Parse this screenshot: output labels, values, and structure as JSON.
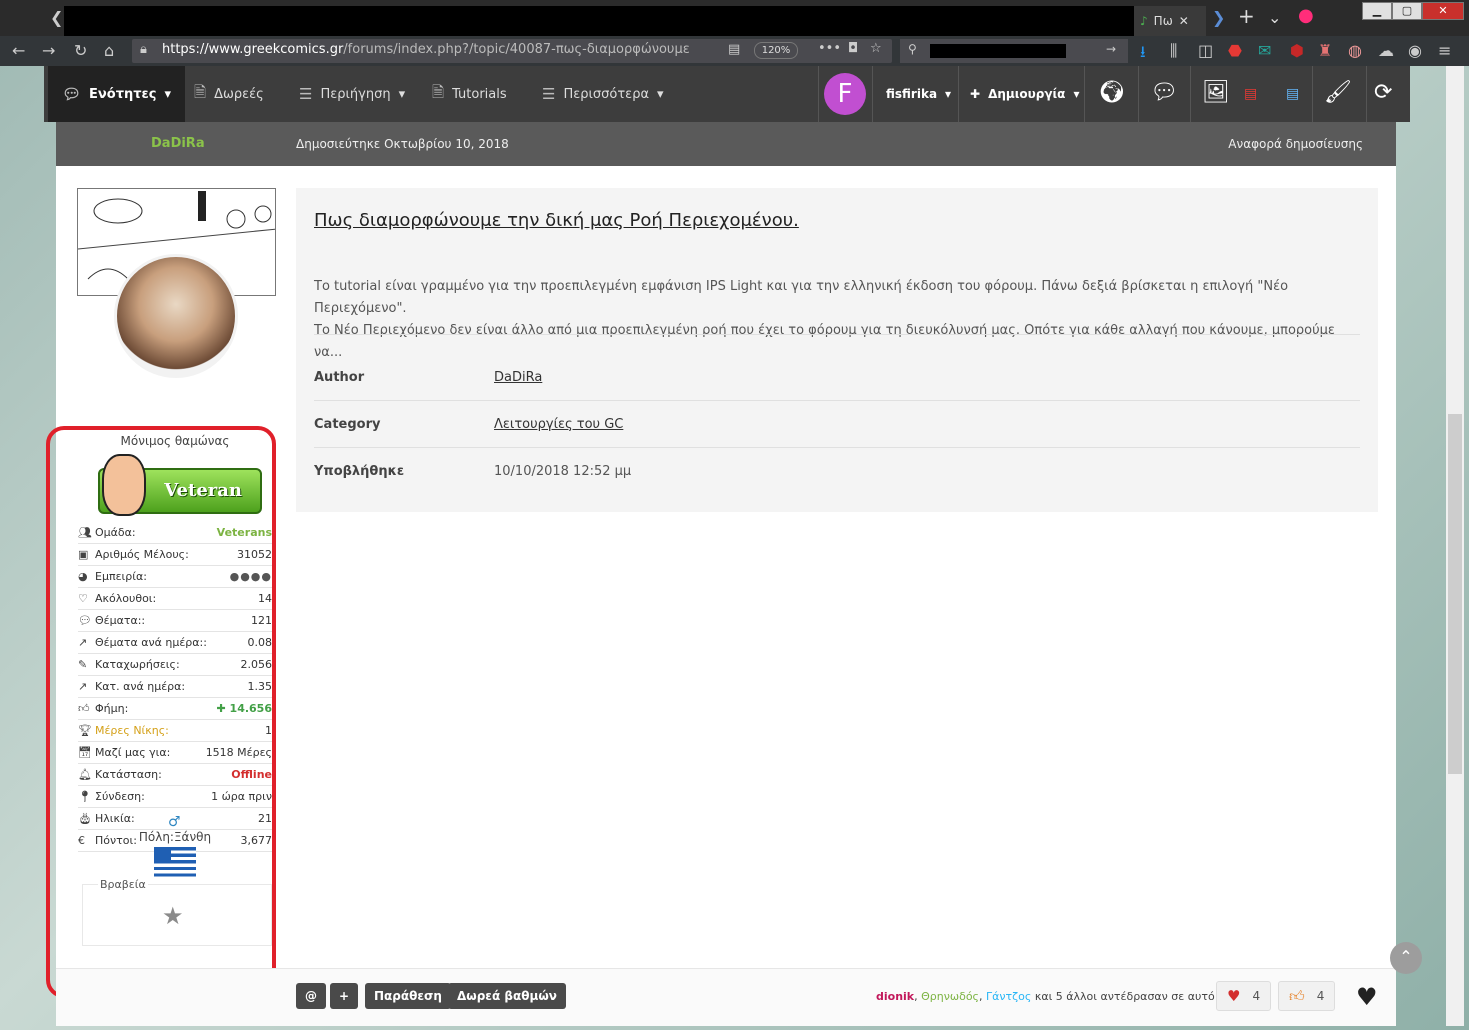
{
  "browser": {
    "tab_title": "Πω",
    "url_host": "https://www.greekcomics.gr",
    "url_path": "/forums/index.php?/topic/40087-πως-διαμορφώνουμε",
    "zoom": "120%"
  },
  "site_nav": {
    "items": [
      {
        "label": "Ενότητες",
        "icon": "comments-icon",
        "active": true
      },
      {
        "label": "Δωρεές",
        "icon": "document-icon"
      },
      {
        "label": "Περιήγηση",
        "icon": "list-icon"
      },
      {
        "label": "Tutorials",
        "icon": "document-icon"
      },
      {
        "label": "Περισσότερα",
        "icon": "list-icon"
      }
    ],
    "avatar_letter": "F",
    "username": "fisfirika",
    "create_label": "Δημιουργία",
    "avatar_color": "#c14fd1"
  },
  "post": {
    "author": "DaDiRa",
    "date": "Δημοσιεύτηκε Οκτωβρίου 10, 2018",
    "report_label": "Αναφορά δημοσίευσης"
  },
  "user_panel": {
    "rank_title": "Μόνιμος θαμώνας",
    "badge_text": "Veteran",
    "stats": [
      {
        "label": "Ομάδα:",
        "value": "Veterans",
        "style": "green"
      },
      {
        "label": "Αριθμός Μέλους:",
        "value": "31052"
      },
      {
        "label": "Εμπειρία:",
        "value": "●●●●"
      },
      {
        "label": "Ακόλουθοι:",
        "value": "14"
      },
      {
        "label": "Θέματα::",
        "value": "121"
      },
      {
        "label": "Θέματα ανά ημέρα::",
        "value": "0.08"
      },
      {
        "label": "Καταχωρήσεις:",
        "value": "2.056"
      },
      {
        "label": "Κατ. ανά ημέρα:",
        "value": "1.35"
      },
      {
        "label": "Φήμη:",
        "value": "✚ 14.656",
        "style": "rep"
      },
      {
        "label": "Μέρες Νίκης:",
        "value": "1",
        "style": "gold"
      },
      {
        "label": "Μαζί μας για:",
        "value": "1518 Μέρες"
      },
      {
        "label": "Κατάσταση:",
        "value": "Offline",
        "style": "red"
      },
      {
        "label": "Σύνδεση:",
        "value": "1 ώρα πριν"
      },
      {
        "label": "Ηλικία:",
        "value": "21"
      },
      {
        "label": "Πόντοι:",
        "value": "3,677"
      }
    ],
    "city": "Πόλη:Ξάνθη",
    "awards_label": "Βραβεία"
  },
  "content": {
    "title": "Πως διαμορφώνουμε την δική μας Ροή Περιεχομένου.",
    "summary_line1": "Το tutorial είναι γραμμένο για την προεπιλεγμένη εμφάνιση IPS Light και για την ελληνική έκδοση του φόρουμ.   Πάνω δεξιά βρίσκεται η επιλογή \"Νέο Περιεχόμενο\".",
    "summary_line2": "Το Νέο Περιεχόμενο δεν είναι άλλο από μια προεπιλεγμένη ροή που έχει το φόρουμ για τη διευκόλυνσή μας. Οπότε για κάθε αλλαγή που κάνουμε, μπορούμε να...",
    "meta": [
      {
        "key": "Author",
        "value": "DaDiRa",
        "link": true
      },
      {
        "key": "Category",
        "value": "Λειτουργίες του GC",
        "link": true
      },
      {
        "key": "Υποβλήθηκε",
        "value": "10/10/2018 12:52 μμ",
        "link": false
      }
    ]
  },
  "actions": {
    "mention": "@",
    "plus": "+",
    "quote": "Παράθεση",
    "donate": "Δωρεά βαθμών",
    "reactor1": "dionik",
    "reactor2": "Θρηνωδός",
    "reactor3": "Γάντζος",
    "reactors_suffix": "και 5 άλλοι αντέδρασαν σε αυτό",
    "heart_count": "4",
    "thumb_count": "4"
  }
}
